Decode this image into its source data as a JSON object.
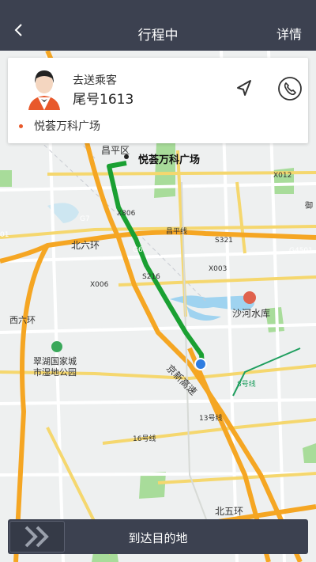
{
  "header": {
    "title": "行程中",
    "detail_label": "详情"
  },
  "card": {
    "task": "去送乘客",
    "plate": "尾号1613",
    "destination": "悦荟万科广场"
  },
  "map": {
    "destination_label": "悦荟万科广场",
    "district_label": "昌平区",
    "labels": {
      "x012": "X012",
      "g7": "G7",
      "x806": "X806",
      "changping_line": "昌平线",
      "s321": "S321",
      "g4501": "G4501",
      "north6": "北六环",
      "g6": "G6",
      "x003": "X003",
      "s216": "S216",
      "x006": "X006",
      "shahe": "沙河水库",
      "west6": "西六环",
      "cuihu1": "翠湖国家城",
      "cuihu2": "市湿地公园",
      "jingxin": "京新高速",
      "line8": "8号线",
      "line13": "13号线",
      "line16": "16号线",
      "north5": "北五环",
      "edge_left": "01",
      "edge_right": "御"
    }
  },
  "bottom": {
    "action_label": "到达目的地"
  },
  "colors": {
    "header_bg": "#3c4150",
    "route": "#1aa032",
    "highway": "#f5a623",
    "water": "#9fd3f0",
    "park": "#a8dc9a",
    "accent_dot": "#e8592b"
  }
}
